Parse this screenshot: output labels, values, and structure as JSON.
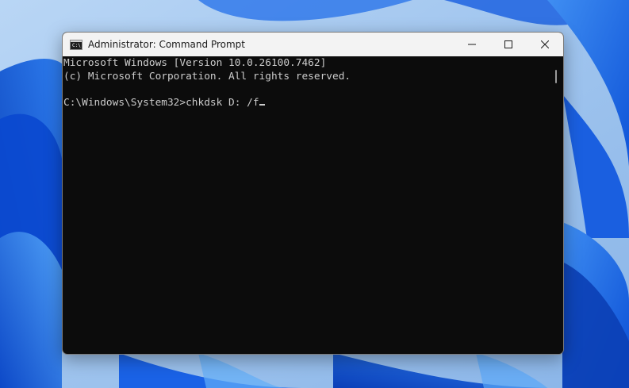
{
  "window": {
    "title": "Administrator: Command Prompt",
    "app_icon_glyph": "C:\\",
    "controls": {
      "minimize": "minimize-icon",
      "maximize": "maximize-icon",
      "close": "close-icon"
    }
  },
  "console": {
    "lines": [
      "Microsoft Windows [Version 10.0.26100.7462]",
      "(c) Microsoft Corporation. All rights reserved.",
      "",
      "C:\\Windows\\System32>chkdsk D: /f"
    ]
  },
  "colors": {
    "console_background": "#0c0c0c",
    "console_text": "#cccccc",
    "titlebar": "#f3f3f3"
  }
}
